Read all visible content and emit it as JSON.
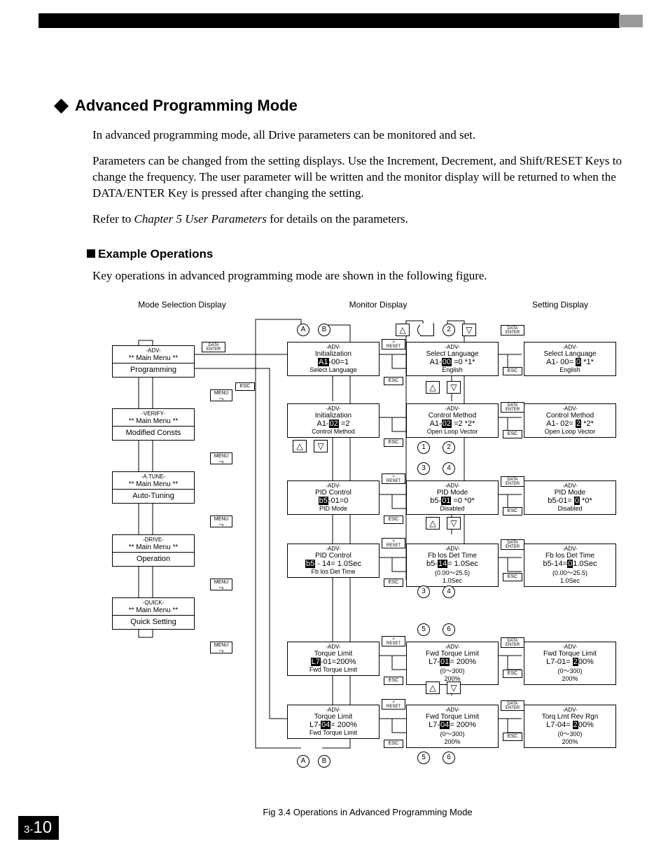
{
  "heading": "Advanced Programming Mode",
  "para1": "In advanced programming mode, all Drive parameters can be monitored and set.",
  "para2": "Parameters can be changed from the setting displays. Use the Increment, Decrement, and Shift/RESET Keys to change the frequency. The user parameter will be written and the monitor display will be returned to when the DATA/ENTER Key is pressed after changing the setting.",
  "para3a": "Refer to ",
  "para3b": "Chapter 5 User Parameters",
  "para3c": " for details on the parameters.",
  "subheading": "Example Operations",
  "para4": "Key operations in advanced programming mode are shown in the following figure.",
  "columns": {
    "c1": "Mode Selection Display",
    "c2": "Monitor Display",
    "c3": "Setting Display"
  },
  "keys": {
    "menu": "MENU",
    "esc": "ESC",
    "data_enter_1": "DATA",
    "data_enter_2": "ENTER",
    "reset_1": ">",
    "reset_2": "RESET"
  },
  "menus": {
    "m1": {
      "top": "-ADV-",
      "mid": "** Main Menu **",
      "bot": "Programming"
    },
    "m2": {
      "top": "-VERIFY-",
      "mid": "** Main Menu **",
      "bot": "Modified Consts"
    },
    "m3": {
      "top": "-A.TUNE-",
      "mid": "** Main Menu **",
      "bot": "Auto-Tuning"
    },
    "m4": {
      "top": "-DRIVE-",
      "mid": "** Main Menu **",
      "bot": "Operation"
    },
    "m5": {
      "top": "-QUICK-",
      "mid": "** Main Menu **",
      "bot": "Quick Setting"
    }
  },
  "mid": {
    "d1": {
      "t1": "-ADV-",
      "t2": "Initialization",
      "t3a": "A1",
      "t3b": "-00=1",
      "t4": "Select Language"
    },
    "d2": {
      "t1": "-ADV-",
      "t2": "Initialization",
      "t3a": "A1-",
      "t3b": "02",
      "t3c": " =2",
      "t4": "Control Method"
    },
    "d3": {
      "t1": "-ADV-",
      "t2": "PID Control",
      "t3a": "b5",
      "t3b": "-01=0",
      "t4": "PID Mode"
    },
    "d4": {
      "t1": "-ADV-",
      "t2": "PID Control",
      "t3a": "b5",
      "t3b": " - 14= 1.0Sec",
      "t4": "Fb los Det Time"
    },
    "d5": {
      "t1": "-ADV-",
      "t2": "Torque Limit",
      "t3a": "L7",
      "t3b": "-01=200%",
      "t4": "Fwd Torque Limit"
    },
    "d6": {
      "t1": "-ADV-",
      "t2": "Torque Limit",
      "t3a": "L7-",
      "t3b": "04",
      "t3c": "= 200%",
      "t4": "Fwd Torque Limit"
    }
  },
  "mon": {
    "r1": {
      "t1": "-ADV-",
      "t2": "Select Language",
      "t3": "A1-00 =0 *1*",
      "hl": "00",
      "t4": "English"
    },
    "r2": {
      "t1": "-ADV-",
      "t2": "Control Method",
      "t3": "A1-02 =2 *2*",
      "hl": "02",
      "t4": "Open Loop Vector"
    },
    "r3": {
      "t1": "-ADV-",
      "t2": "PID Mode",
      "t3": "b5-01 =0 *0*",
      "hl": "01",
      "t4": "Disabled"
    },
    "r4": {
      "t1": "-ADV-",
      "t2": "Fb los Det Time",
      "t3": "b5-14= 1.0Sec",
      "hl": "14",
      "t4a": "(0.00～25.5)",
      "t4b": "1.0Sec"
    },
    "r5": {
      "t1": "-ADV-",
      "t2": "Fwd Torque Limit",
      "t3": "L7-01= 200%",
      "hl": "01",
      "t4a": "(0～300)",
      "t4b": "200%"
    },
    "r6": {
      "t1": "-ADV-",
      "t2": "Fwd Torque Limit",
      "t3": "L7-04= 200%",
      "hl": "04",
      "t4a": "(0～300)",
      "t4b": "200%"
    }
  },
  "set": {
    "r1": {
      "t1": "-ADV-",
      "t2": "Select Language",
      "t3a": "A1- 00= ",
      "hl": "0",
      "t3b": " *1*",
      "t4": "English"
    },
    "r2": {
      "t1": "-ADV-",
      "t2": "Control Method",
      "t3a": "A1- 02= ",
      "hl": "2",
      "t3b": " *2*",
      "t4": "Open Loop Vector"
    },
    "r3": {
      "t1": "-ADV-",
      "t2": "PID Mode",
      "t3a": "b5-01= ",
      "hl": "0",
      "t3b": " *0*",
      "t4": "Disabled"
    },
    "r4": {
      "t1": "-ADV-",
      "t2": "Fb los Det Time",
      "t3a": "b5-14=",
      "hl": "0",
      "t3b": "1.0Sec",
      "t4a": "(0.00～25.5)",
      "t4b": "1.0Sec"
    },
    "r5": {
      "t1": "-ADV-",
      "t2": "Fwd Torque Limit",
      "t3a": "L7-01= ",
      "hl": "2",
      "t3b": "00%",
      "t4a": "(0～300)",
      "t4b": "200%"
    },
    "r6": {
      "t1": "-ADV-",
      "t2": "Torq Lmt Rev Rgn",
      "t3a": "L7-04= ",
      "hl": "2",
      "t3b": "00%",
      "t4a": "(0～300)",
      "t4b": "200%"
    }
  },
  "circles": {
    "A": "A",
    "B": "B",
    "n1": "1",
    "n2": "2",
    "n3": "3",
    "n4": "4",
    "n5": "5",
    "n6": "6"
  },
  "caption": "Fig 3.4  Operations in Advanced Programming Mode",
  "pagenum_small": "3-",
  "pagenum_big": "10"
}
